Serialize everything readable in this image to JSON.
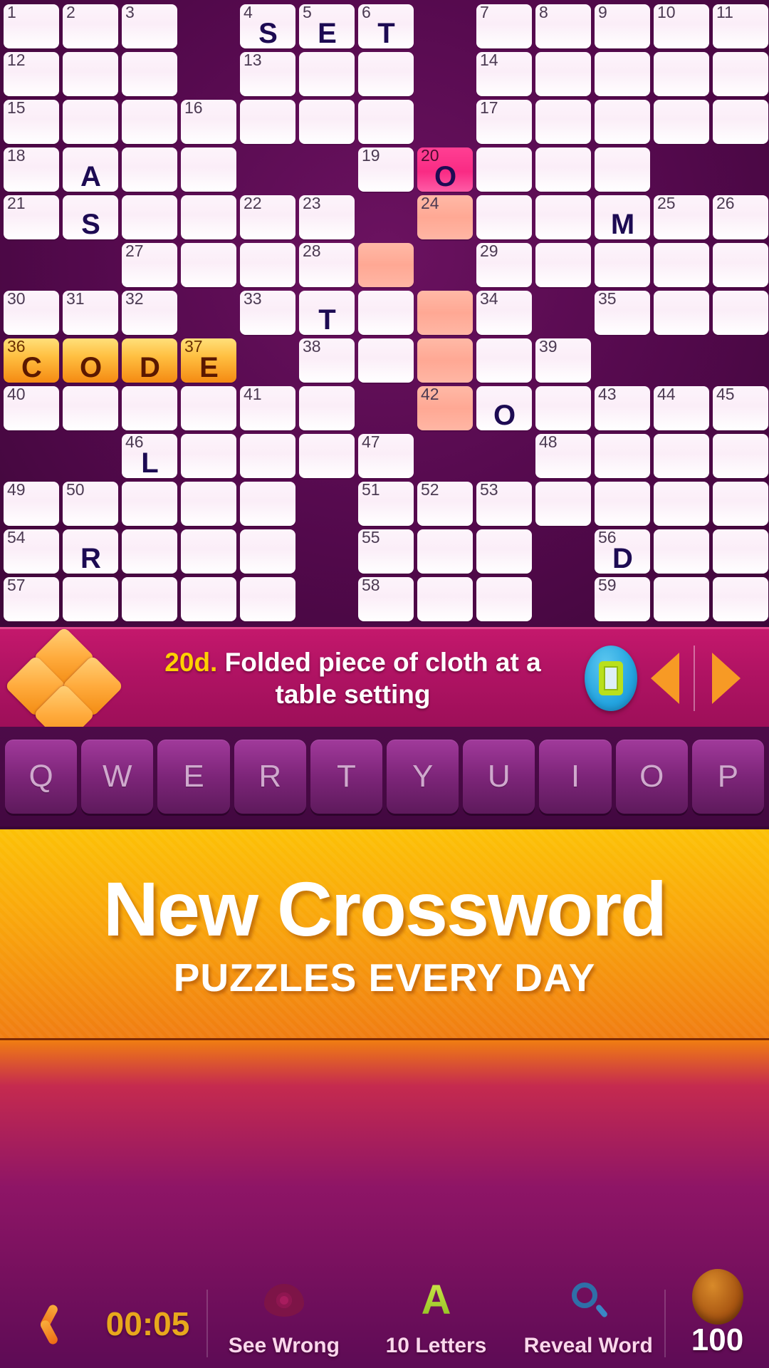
{
  "grid": {
    "columns": 13,
    "rows": 13,
    "cells": [
      [
        {
          "s": "open",
          "n": "1"
        },
        {
          "s": "open",
          "n": "2"
        },
        {
          "s": "open",
          "n": "3"
        },
        {
          "s": "block"
        },
        {
          "s": "open",
          "n": "4",
          "l": "S"
        },
        {
          "s": "open",
          "n": "5",
          "l": "E"
        },
        {
          "s": "open",
          "n": "6",
          "l": "T"
        },
        {
          "s": "block"
        },
        {
          "s": "open",
          "n": "7"
        },
        {
          "s": "open",
          "n": "8"
        },
        {
          "s": "open",
          "n": "9"
        },
        {
          "s": "open",
          "n": "10"
        },
        {
          "s": "open",
          "n": "11"
        }
      ],
      [
        {
          "s": "open",
          "n": "12"
        },
        {
          "s": "open"
        },
        {
          "s": "open"
        },
        {
          "s": "block"
        },
        {
          "s": "open",
          "n": "13"
        },
        {
          "s": "open"
        },
        {
          "s": "open"
        },
        {
          "s": "block"
        },
        {
          "s": "open",
          "n": "14"
        },
        {
          "s": "open"
        },
        {
          "s": "open"
        },
        {
          "s": "open"
        },
        {
          "s": "open"
        }
      ],
      [
        {
          "s": "open",
          "n": "15"
        },
        {
          "s": "open"
        },
        {
          "s": "open"
        },
        {
          "s": "open",
          "n": "16"
        },
        {
          "s": "open"
        },
        {
          "s": "open"
        },
        {
          "s": "open"
        },
        {
          "s": "block"
        },
        {
          "s": "open",
          "n": "17"
        },
        {
          "s": "open"
        },
        {
          "s": "open"
        },
        {
          "s": "open"
        },
        {
          "s": "open"
        }
      ],
      [
        {
          "s": "open",
          "n": "18"
        },
        {
          "s": "open",
          "l": "A"
        },
        {
          "s": "open"
        },
        {
          "s": "open"
        },
        {
          "s": "block"
        },
        {
          "s": "block"
        },
        {
          "s": "open",
          "n": "19"
        },
        {
          "s": "active",
          "n": "20",
          "l": "O"
        },
        {
          "s": "open"
        },
        {
          "s": "open"
        },
        {
          "s": "open"
        },
        {
          "s": "block"
        },
        {
          "s": "block"
        }
      ],
      [
        {
          "s": "open",
          "n": "21"
        },
        {
          "s": "open",
          "l": "S"
        },
        {
          "s": "open"
        },
        {
          "s": "open"
        },
        {
          "s": "open",
          "n": "22"
        },
        {
          "s": "open",
          "n": "23"
        },
        {
          "s": "block"
        },
        {
          "s": "word",
          "n": "24"
        },
        {
          "s": "open"
        },
        {
          "s": "open"
        },
        {
          "s": "open",
          "l": "M"
        },
        {
          "s": "open",
          "n": "25"
        },
        {
          "s": "open",
          "n": "26"
        }
      ],
      [
        {
          "s": "block"
        },
        {
          "s": "block"
        },
        {
          "s": "open",
          "n": "27"
        },
        {
          "s": "open"
        },
        {
          "s": "open"
        },
        {
          "s": "open",
          "n": "28"
        },
        {
          "s": "word"
        },
        {
          "s": "block"
        },
        {
          "s": "open",
          "n": "29"
        },
        {
          "s": "open"
        },
        {
          "s": "open"
        },
        {
          "s": "open"
        },
        {
          "s": "open"
        }
      ],
      [
        {
          "s": "open",
          "n": "30"
        },
        {
          "s": "open",
          "n": "31"
        },
        {
          "s": "open",
          "n": "32"
        },
        {
          "s": "block"
        },
        {
          "s": "open",
          "n": "33"
        },
        {
          "s": "open",
          "l": "T"
        },
        {
          "s": "open"
        },
        {
          "s": "word"
        },
        {
          "s": "open",
          "n": "34"
        },
        {
          "s": "block"
        },
        {
          "s": "open",
          "n": "35"
        },
        {
          "s": "open"
        },
        {
          "s": "open"
        }
      ],
      [
        {
          "s": "solved",
          "n": "36",
          "l": "C"
        },
        {
          "s": "solved",
          "l": "O"
        },
        {
          "s": "solved",
          "l": "D"
        },
        {
          "s": "solved",
          "n": "37",
          "l": "E"
        },
        {
          "s": "block"
        },
        {
          "s": "open",
          "n": "38"
        },
        {
          "s": "open"
        },
        {
          "s": "word"
        },
        {
          "s": "open"
        },
        {
          "s": "open",
          "n": "39"
        },
        {
          "s": "block"
        },
        {
          "s": "block"
        },
        {
          "s": "block"
        }
      ],
      [
        {
          "s": "open",
          "n": "40"
        },
        {
          "s": "open"
        },
        {
          "s": "open"
        },
        {
          "s": "open"
        },
        {
          "s": "open",
          "n": "41"
        },
        {
          "s": "open"
        },
        {
          "s": "block"
        },
        {
          "s": "word",
          "n": "42"
        },
        {
          "s": "open",
          "l": "O"
        },
        {
          "s": "open"
        },
        {
          "s": "open",
          "n": "43"
        },
        {
          "s": "open",
          "n": "44"
        },
        {
          "s": "open",
          "n": "45"
        }
      ],
      [
        {
          "s": "block"
        },
        {
          "s": "block"
        },
        {
          "s": "open",
          "n": "46",
          "l": "L"
        },
        {
          "s": "open"
        },
        {
          "s": "open"
        },
        {
          "s": "open"
        },
        {
          "s": "open",
          "n": "47"
        },
        {
          "s": "block"
        },
        {
          "s": "block"
        },
        {
          "s": "open",
          "n": "48"
        },
        {
          "s": "open"
        },
        {
          "s": "open"
        },
        {
          "s": "open"
        }
      ],
      [
        {
          "s": "open",
          "n": "49"
        },
        {
          "s": "open",
          "n": "50"
        },
        {
          "s": "open"
        },
        {
          "s": "open"
        },
        {
          "s": "open"
        },
        {
          "s": "block"
        },
        {
          "s": "open",
          "n": "51"
        },
        {
          "s": "open",
          "n": "52"
        },
        {
          "s": "open",
          "n": "53"
        },
        {
          "s": "open"
        },
        {
          "s": "open"
        },
        {
          "s": "open"
        },
        {
          "s": "open"
        }
      ],
      [
        {
          "s": "open",
          "n": "54"
        },
        {
          "s": "open",
          "l": "R"
        },
        {
          "s": "open"
        },
        {
          "s": "open"
        },
        {
          "s": "open"
        },
        {
          "s": "block"
        },
        {
          "s": "open",
          "n": "55"
        },
        {
          "s": "open"
        },
        {
          "s": "open"
        },
        {
          "s": "block"
        },
        {
          "s": "open",
          "n": "56",
          "l": "D"
        },
        {
          "s": "open"
        },
        {
          "s": "open"
        }
      ],
      [
        {
          "s": "open",
          "n": "57"
        },
        {
          "s": "open"
        },
        {
          "s": "open"
        },
        {
          "s": "open"
        },
        {
          "s": "open"
        },
        {
          "s": "block"
        },
        {
          "s": "open",
          "n": "58"
        },
        {
          "s": "open"
        },
        {
          "s": "open"
        },
        {
          "s": "block"
        },
        {
          "s": "open",
          "n": "59"
        },
        {
          "s": "open"
        },
        {
          "s": "open"
        }
      ]
    ]
  },
  "clue": {
    "number": "20d.",
    "text": "Folded piece of cloth at a table setting",
    "prev_label": "previous-clue",
    "next_label": "next-clue"
  },
  "keyboard": {
    "keys": [
      "Q",
      "W",
      "E",
      "R",
      "T",
      "Y",
      "U",
      "I",
      "O",
      "P"
    ]
  },
  "ad": {
    "title": "New Crossword",
    "subtitle": "PUZZLES EVERY DAY"
  },
  "bottom": {
    "timer": "00:05",
    "tools": [
      {
        "label": "See Wrong",
        "icon": "eye-icon"
      },
      {
        "label": "10 Letters",
        "icon": "letter-a-icon"
      },
      {
        "label": "Reveal Word",
        "icon": "magnifier-icon"
      }
    ],
    "coins": "100"
  },
  "colors": {
    "board_bg": "#53094c",
    "cell": "#fbeef8",
    "active_cell": "#f92b84",
    "word_cell": "#ffa894",
    "solved_cell": "#f9a714",
    "clue_bar": "#b01363",
    "accent_orange": "#f79a25",
    "timer": "#e8a81c"
  }
}
